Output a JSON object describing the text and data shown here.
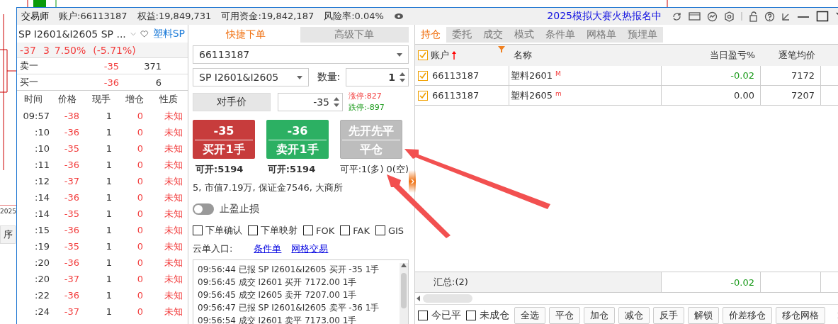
{
  "background": {
    "year": "2025",
    "tab": "序"
  },
  "title_bar": {
    "app": "交易师",
    "account": "账户:66113187",
    "equity": "权益:19,849,731",
    "available": "可用资金:19,842,187",
    "risk": "风险率:0.04%",
    "promo": "2025模拟大赛火热报名中"
  },
  "quote": {
    "symbol": "SP I2601&I2605 SP ...",
    "name": "塑料SP",
    "change": [
      "-37",
      "3",
      "7.50%",
      "(-5.71%)"
    ],
    "book": [
      {
        "label": "卖一",
        "price": "-35",
        "volume": "371"
      },
      {
        "label": "买一",
        "price": "-36",
        "volume": "6"
      }
    ]
  },
  "ticks": {
    "columns": [
      "时间",
      "价格",
      "现手",
      "增仓",
      "性质"
    ],
    "rows": [
      {
        "time": "09:57",
        "price": "-38",
        "volume": "1",
        "oi": "0",
        "nature": "未知"
      },
      {
        "time": ":10",
        "price": "-36",
        "volume": "1",
        "oi": "0",
        "nature": "未知"
      },
      {
        "time": ":10",
        "price": "-35",
        "volume": "1",
        "oi": "0",
        "nature": "未知"
      },
      {
        "time": ":11",
        "price": "-36",
        "volume": "1",
        "oi": "0",
        "nature": "未知"
      },
      {
        "time": ":12",
        "price": "-37",
        "volume": "1",
        "oi": "0",
        "nature": "未知"
      },
      {
        "time": ":14",
        "price": "-36",
        "volume": "1",
        "oi": "0",
        "nature": "未知"
      },
      {
        "time": ":14",
        "price": "-35",
        "volume": "1",
        "oi": "0",
        "nature": "未知"
      },
      {
        "time": ":15",
        "price": "-36",
        "volume": "1",
        "oi": "0",
        "nature": "未知"
      },
      {
        "time": ":19",
        "price": "-35",
        "volume": "1",
        "oi": "0",
        "nature": "未知"
      },
      {
        "time": ":20",
        "price": "-36",
        "volume": "1",
        "oi": "0",
        "nature": "未知"
      },
      {
        "time": ":20",
        "price": "-37",
        "volume": "1",
        "oi": "0",
        "nature": "未知"
      },
      {
        "time": ":22",
        "price": "-36",
        "volume": "1",
        "oi": "0",
        "nature": "未知"
      },
      {
        "time": ":24",
        "price": "-37",
        "volume": "1",
        "oi": "0",
        "nature": "未知"
      }
    ]
  },
  "order": {
    "tabs": [
      {
        "label": "快捷下单",
        "selected": true
      },
      {
        "label": "高级下单",
        "selected": false
      }
    ],
    "account": "66113187",
    "contract": "SP I2601&I2605",
    "qty_label": "数量:",
    "qty": "1",
    "price_button": "对手价",
    "price": "-35",
    "limit_up": "涨停:827",
    "limit_down": "跌停:-897",
    "actions": [
      {
        "kind": "buy",
        "price": "-35",
        "label": "买开1手",
        "disabled": false
      },
      {
        "kind": "sell",
        "price": "-36",
        "label": "卖开1手",
        "disabled": false
      },
      {
        "kind": "close",
        "price": "先开先平",
        "label": "平仓",
        "disabled": true
      }
    ],
    "availability": [
      "可开:5194",
      "可开:5194",
      "可平:1(多) 0(空)"
    ],
    "info": "5, 市值7.19万, 保证金7546, 大商所",
    "stop_toggle": {
      "label": "止盈止损",
      "on": false
    },
    "options": [
      {
        "label": "下单确认",
        "checked": false
      },
      {
        "label": "下单映射",
        "checked": false
      },
      {
        "label": "FOK",
        "checked": false
      },
      {
        "label": "FAK",
        "checked": false
      },
      {
        "label": "GIS",
        "checked": false
      }
    ],
    "cloud": {
      "label": "云单入口:",
      "links": [
        "条件单",
        "网格交易"
      ]
    },
    "log": [
      "09:56:44 已报 SP I2601&I2605 买开 -35 1手",
      "09:56:45 成交 I2601 买开 7172.00 1手",
      "09:56:45 成交 I2605 卖开 7207.00 1手",
      "09:56:47 已报 SP I2601&I2605 卖平 -36 1手",
      "09:56:54 成交 I2601 卖平 7173.00 1手"
    ]
  },
  "positions": {
    "tabs": [
      {
        "label": "持仓",
        "selected": true
      },
      {
        "label": "委托",
        "selected": false
      },
      {
        "label": "成交",
        "selected": false
      },
      {
        "label": "模式",
        "selected": false
      },
      {
        "label": "条件单",
        "selected": false
      },
      {
        "label": "网格单",
        "selected": false
      },
      {
        "label": "预埋单",
        "selected": false
      }
    ],
    "header_checked": true,
    "columns": [
      "账户",
      "名称",
      "当日盈亏%",
      "逐笔均价"
    ],
    "rows": [
      {
        "checked": true,
        "account": "66113187",
        "name": "塑料2601",
        "tag": "M",
        "pnl": "-0.02",
        "color": "#1a9a1a",
        "avg": "7172"
      },
      {
        "checked": true,
        "account": "66113187",
        "name": "塑料2605",
        "tag": "m",
        "pnl": "0.00",
        "color": "#333333",
        "avg": "7207"
      }
    ],
    "summary": {
      "label": "汇总:(2)",
      "pnl": "-0.02",
      "color": "#1a9a1a"
    },
    "filters": [
      {
        "label": "今已平",
        "checked": false
      },
      {
        "label": "未成仓",
        "checked": false
      }
    ],
    "buttons": [
      "全选",
      "平仓",
      "加仓",
      "减仓",
      "反手",
      "解锁",
      "价差移仓",
      "移仓网格"
    ]
  }
}
